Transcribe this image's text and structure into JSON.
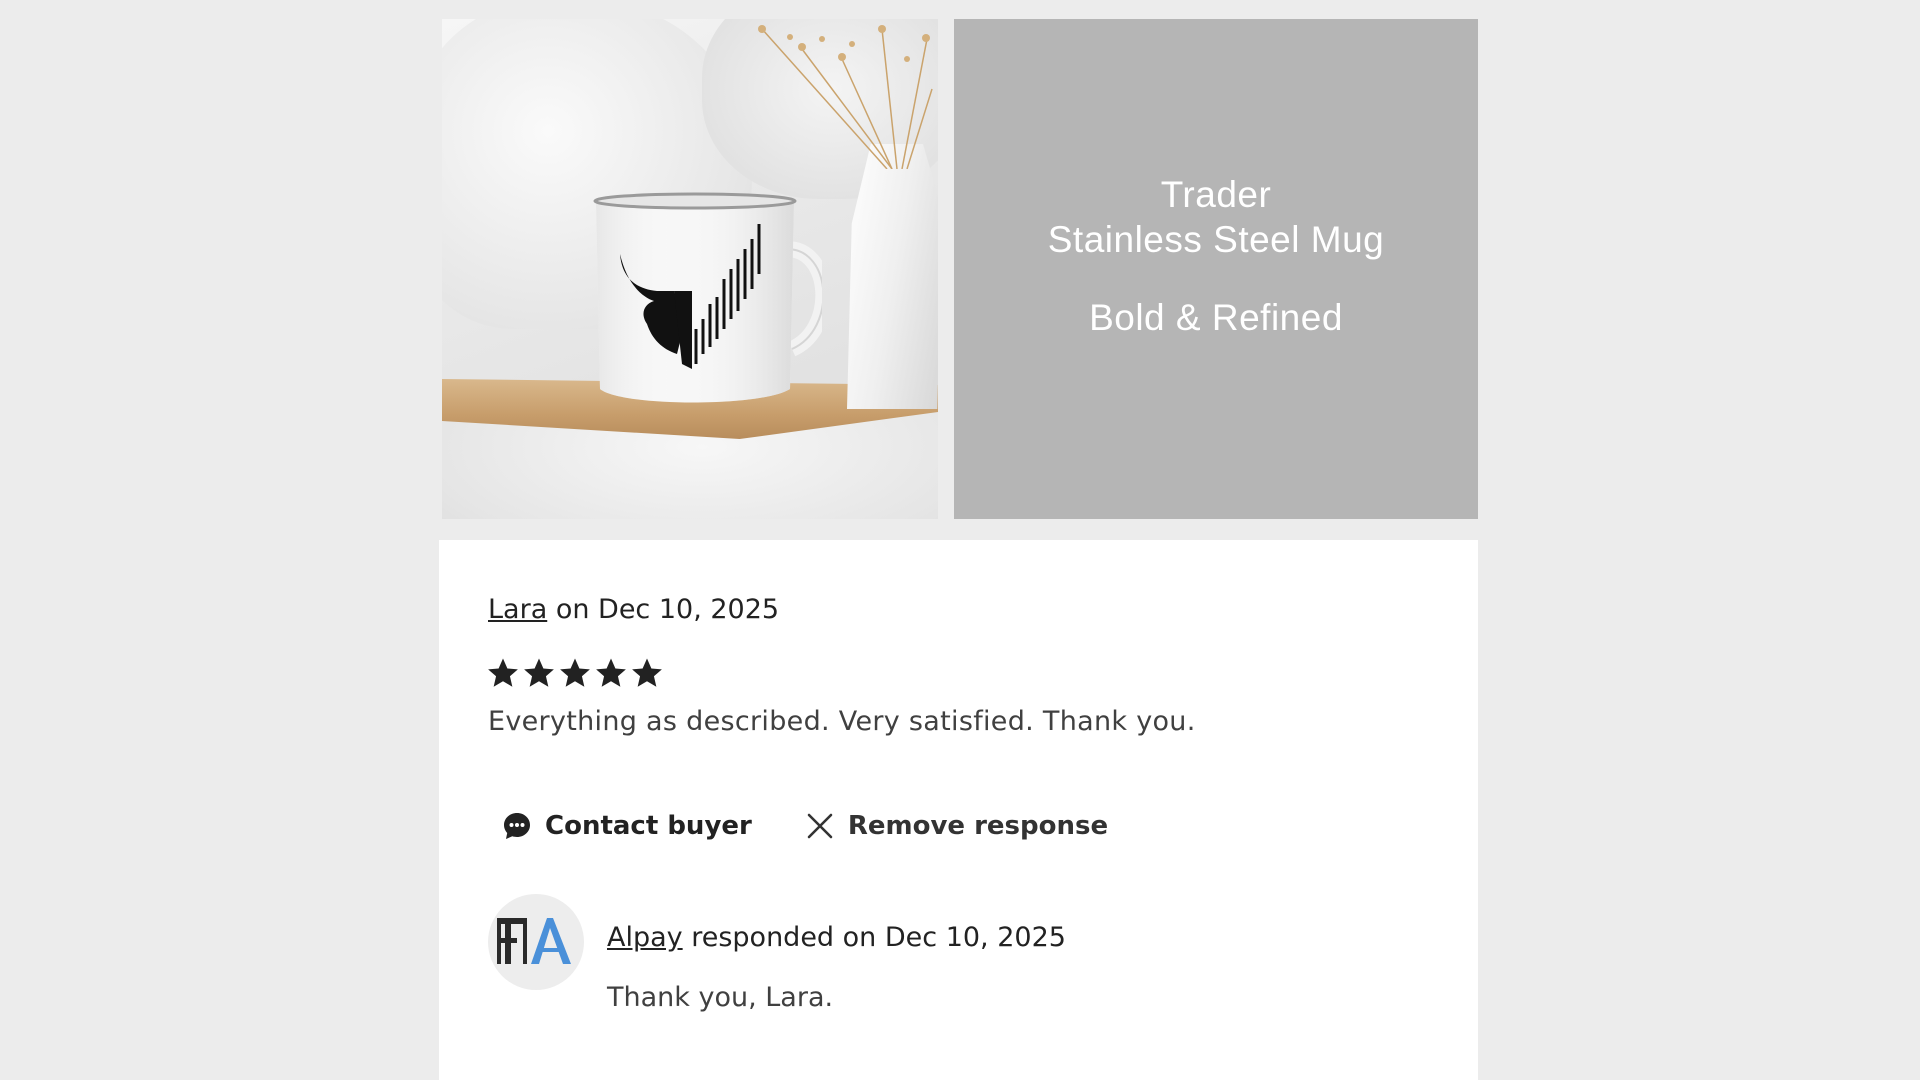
{
  "banner": {
    "line1": "Trader",
    "line2": "Stainless Steel Mug",
    "line3": "Bold & Refined"
  },
  "review": {
    "author": "Lara",
    "date_text": " on Dec 10, 2025",
    "rating": 5,
    "rating_max": 5,
    "text": "Everything as described. Very satisfied. Thank you."
  },
  "actions": {
    "contact_label": "Contact buyer",
    "remove_label": "Remove response"
  },
  "response": {
    "author": "Alpay",
    "date_text": " responded on Dec 10, 2025",
    "text": "Thank you, Lara."
  },
  "colors": {
    "background": "#ececec",
    "banner": "#b5b5b5",
    "card": "#ffffff",
    "text": "#222222",
    "avatar_accent": "#4a90d9"
  },
  "icons": {
    "chat": "chat-bubble-icon",
    "close": "close-icon",
    "star": "star-icon"
  }
}
